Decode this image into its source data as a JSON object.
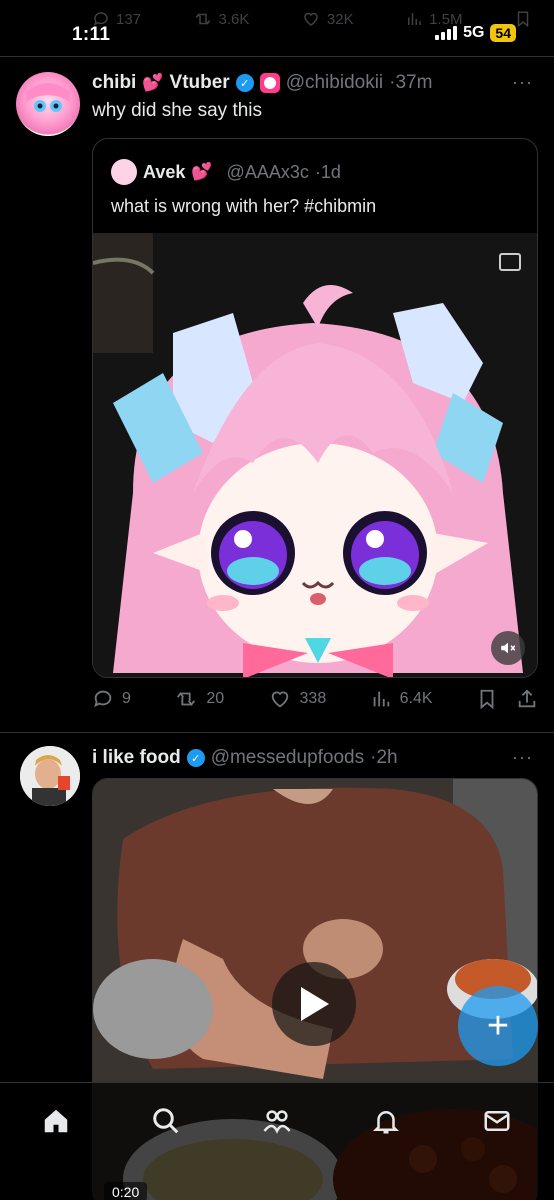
{
  "status_bar": {
    "time": "1:11",
    "network": "5G",
    "battery": "54"
  },
  "previous_tweet_actions": {
    "replies": "137",
    "reposts": "3.6K",
    "likes": "32K",
    "views": "1.5M"
  },
  "tweet1": {
    "display_name": "chibi",
    "display_name_suffix": "Vtuber",
    "name_emoji": "💕",
    "handle": "@chibidokii",
    "time": "·37m",
    "text": "why did she say this",
    "quote": {
      "display_name": "Avek",
      "name_emoji": "💕",
      "handle": "@AAAx3c",
      "time": "·1d",
      "text": "what is wrong with her? #chibmin"
    },
    "actions": {
      "replies": "9",
      "reposts": "20",
      "likes": "338",
      "views": "6.4K"
    }
  },
  "tweet2": {
    "display_name": "i like food",
    "handle": "@messedupfoods",
    "time": "·2h",
    "video_timestamp": "0:20"
  },
  "colors": {
    "accent": "#1d9bf0",
    "muted": "#71767b",
    "divider": "#2f3336",
    "battery": "#f1c40f"
  },
  "tabbar": {
    "icons": [
      "home-icon",
      "search-icon",
      "communities-icon",
      "notifications-icon",
      "messages-icon"
    ]
  }
}
